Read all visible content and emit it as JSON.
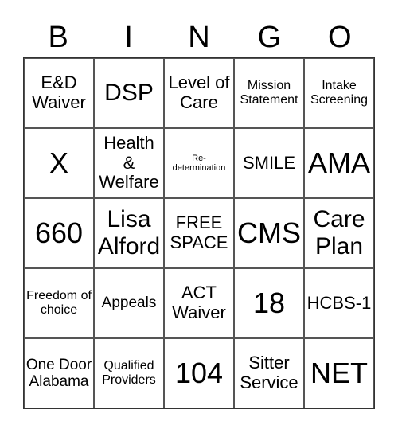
{
  "header": {
    "letters": [
      "B",
      "I",
      "N",
      "G",
      "O"
    ]
  },
  "board": {
    "rows": [
      [
        {
          "text": "E&D Waiver",
          "size": "m"
        },
        {
          "text": "DSP",
          "size": "l"
        },
        {
          "text": "Level of Care",
          "size": "m"
        },
        {
          "text": "Mission Statement",
          "size": "xs"
        },
        {
          "text": "Intake Screening",
          "size": "xs"
        }
      ],
      [
        {
          "text": "X",
          "size": "xl"
        },
        {
          "text": "Health & Welfare",
          "size": "m"
        },
        {
          "text": "Re-determination",
          "size": "xxs"
        },
        {
          "text": "SMILE",
          "size": "m"
        },
        {
          "text": "AMA",
          "size": "xl"
        }
      ],
      [
        {
          "text": "660",
          "size": "xl"
        },
        {
          "text": "Lisa Alford",
          "size": "l"
        },
        {
          "text": "FREE SPACE",
          "size": "m"
        },
        {
          "text": "CMS",
          "size": "xl"
        },
        {
          "text": "Care Plan",
          "size": "l"
        }
      ],
      [
        {
          "text": "Freedom of choice",
          "size": "xs"
        },
        {
          "text": "Appeals",
          "size": "s"
        },
        {
          "text": "ACT Waiver",
          "size": "m"
        },
        {
          "text": "18",
          "size": "xl"
        },
        {
          "text": "HCBS-1",
          "size": "m"
        }
      ],
      [
        {
          "text": "One Door Alabama",
          "size": "s"
        },
        {
          "text": "Qualified Providers",
          "size": "xs"
        },
        {
          "text": "104",
          "size": "xl"
        },
        {
          "text": "Sitter Service",
          "size": "m"
        },
        {
          "text": "NET",
          "size": "xl"
        }
      ]
    ]
  }
}
